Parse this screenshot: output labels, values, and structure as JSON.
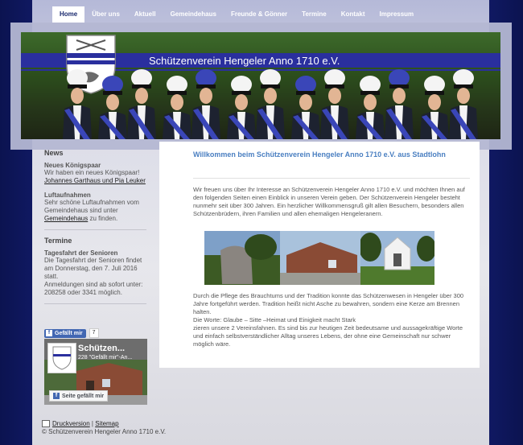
{
  "nav": {
    "items": [
      {
        "label": "Home",
        "active": true
      },
      {
        "label": "Über uns"
      },
      {
        "label": "Aktuell"
      },
      {
        "label": "Gemeindehaus"
      },
      {
        "label": "Freunde & Gönner"
      },
      {
        "label": "Termine"
      },
      {
        "label": "Kontakt"
      },
      {
        "label": "Impressum"
      }
    ]
  },
  "header": {
    "title": "Schützenverein Hengeler Anno 1710 e.V.",
    "brand_color": "#2a2f9e"
  },
  "sidebar": {
    "news_heading": "News",
    "news1_title": "Neues Königspaar",
    "news1_text": "Wir haben ein neues Königspaar!",
    "news1_link": "Johannes Garthaus und Pia Leuker",
    "news2_title": "Luftaufnahmen",
    "news2_text": "Sehr schöne Luftaufnahmen vom Gemeindehaus sind unter",
    "news2_link": "Gemeindehaus",
    "news2_suffix": " zu finden.",
    "termine_heading": "Termine",
    "termin1_title": "Tagesfahrt der Senioren",
    "termin1_text": "Die Tagesfahrt der Senioren findet am Donnerstag, den 7. Juli 2016 statt.",
    "termin1_text2": "Anmeldungen sind ab sofort unter: 208258 oder 3341 möglich."
  },
  "facebook": {
    "like_label": "Gefällt mir",
    "like_count": "7",
    "page_name": "Schützen...",
    "page_likes": "228 \"Gefällt mir\"-An...",
    "page_like_button": "Seite gefällt mir"
  },
  "main": {
    "title": "Willkommen beim Schützenverein Hengeler Anno 1710 e.V. aus Stadtlohn",
    "para1": "Wir freuen uns über Ihr Interesse an Schützenverein Hengeler Anno 1710 e.V. und möchten Ihnen auf den folgenden Seiten einen Einblick in unseren Verein geben. Der Schützenverein Hengeler besteht nunmehr seit über 300 Jahren. Ein herzlicher Willkommensgruß gilt allen Besuchern, besonders allen Schützenbrüdern, ihren Familien und allen ehemaligen Hengeleranern.",
    "para2_line1": "Durch die Pflege des Brauchtums und der Tradition konnte das Schützenwesen in Hengeler über 300 Jahre fortgeführt werden. Tradition heißt nicht Asche zu bewahren, sondern eine Kerze am Brennen halten.",
    "para2_line2": "Die Worte:  Glaube – Sitte –Heimat und Einigkeit macht Stark",
    "para2_line3": "zieren unsere 2 Vereinsfahnen. Es sind bis zur heutigen Zeit bedeutsame und aussagekräftige Worte und einfach selbstverständlicher Alltag unseres Lebens, der ohne eine Gemeinschaft nur schwer möglich wäre.",
    "title_color": "#4a7fc1"
  },
  "footer": {
    "print_label": "Druckversion",
    "separator": "|",
    "sitemap_label": "Sitemap",
    "copyright": "© Schützenverein Hengeler Anno 1710 e.V."
  }
}
